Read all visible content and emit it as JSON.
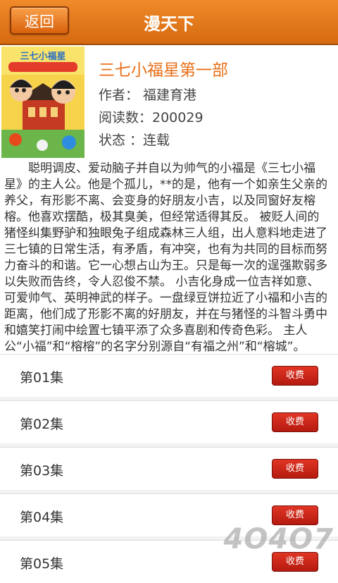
{
  "header": {
    "back_label": "返回",
    "title": "漫天下"
  },
  "book": {
    "cover_caption": "三七小福星",
    "title": "三七小福星第一部",
    "author_line": "作者： 福建育港",
    "reads_line": "阅读数：200029",
    "status_line": "状态 ：连载"
  },
  "summary": "聪明调皮、爱动脑子并自以为帅气的小福是《三七小福星》的主人公。他是个孤儿，**的是，他有一个如亲生父亲的养父，有形影不离、会变身的好朋友小吉，以及同窗好友榕榕。他喜欢摆酷，极其臭美，但经常适得其反。 被贬人间的猪怪纠集野驴和独眼兔子组成森林三人组，出人意料地走进了三七镇的日常生活，有矛盾，有冲突，也有为共同的目标而努力奋斗的和谐。它一心想占山为王。只是每一次的逞强欺弱多以失败而告终，令人忍俊不禁。 小吉化身成一位吉祥如意、可爱帅气、英明神武的样子。一盘绿豆饼拉近了小福和小吉的距离，他们成了形影不离的好朋友，并在与猪怪的斗智斗勇中和嬉笑打闹中绘置七镇平添了众多喜剧和传奇色彩。 主人公“小福”和“榕榕”的名字分别源自“有福之州”和“榕城”。",
  "episodes": [
    {
      "label": "第01集",
      "fee_label": "收费"
    },
    {
      "label": "第02集",
      "fee_label": "收费"
    },
    {
      "label": "第03集",
      "fee_label": "收费"
    },
    {
      "label": "第04集",
      "fee_label": "收费"
    },
    {
      "label": "第05集",
      "fee_label": "收费"
    }
  ],
  "watermark": "4O4O7",
  "colors": {
    "header": "#e77c1e",
    "title_accent": "#e8701a",
    "fee_button": "#c8261a"
  }
}
